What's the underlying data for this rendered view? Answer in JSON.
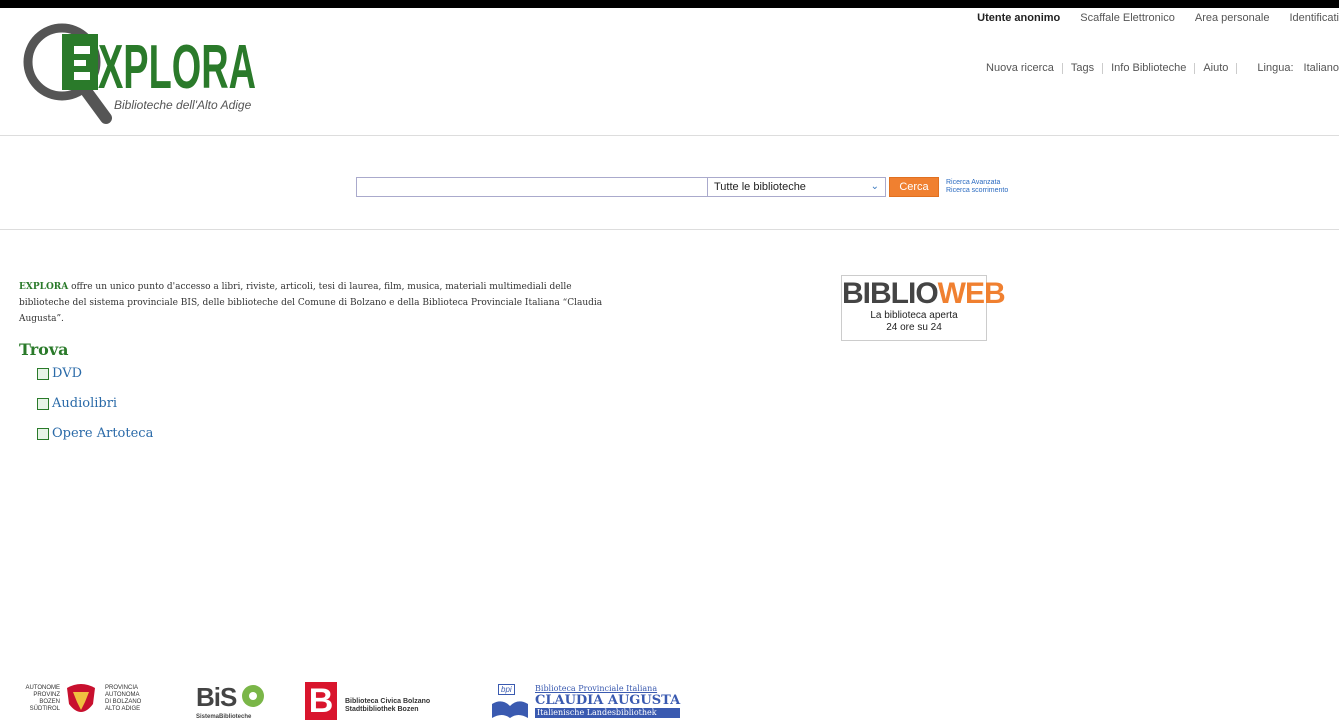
{
  "usernav": {
    "user": "Utente anonimo",
    "items": [
      "Scaffale Elettronico",
      "Area personale",
      "Identificati"
    ]
  },
  "logo": {
    "name": "EXPLORA",
    "subtitle": "Biblioteche dell'Alto Adige"
  },
  "mainnav": {
    "items": [
      "Nuova ricerca",
      "Tags",
      "Info Biblioteche",
      "Aiuto"
    ],
    "language_label": "Lingua:",
    "language_value": "Italiano"
  },
  "search": {
    "placeholder": "",
    "value": "",
    "library_select": "Tutte le biblioteche",
    "button": "Cerca",
    "advanced": "Ricerca Avanzata",
    "browse": "Ricerca scorrimento"
  },
  "intro": {
    "brand": "EXPLORA",
    "text": " offre un unico punto d'accesso a libri, riviste, articoli, tesi di laurea, film, musica, materiali multimediali delle biblioteche del sistema provinciale BIS, delle biblioteche del Comune di Bolzano e della Biblioteca Provinciale Italiana “Claudia Augusta”."
  },
  "find": {
    "title": "Trova",
    "links": [
      {
        "label": "DVD",
        "icon": "video-file-icon"
      },
      {
        "label": "Audiolibri",
        "icon": "audio-file-icon"
      },
      {
        "label": "Opere Artoteca",
        "icon": "image-icon"
      }
    ]
  },
  "biblioweb": {
    "title_a": "BIBLIO",
    "title_b": "WEB",
    "line1": "La biblioteca aperta",
    "line2": "24 ore su 24"
  },
  "footer": {
    "province_de": [
      "AUTONOME",
      "PROVINZ",
      "BOZEN",
      "SÜDTIROL"
    ],
    "province_it": [
      "PROVINCIA",
      "AUTONOMA",
      "DI BOLZANO",
      "ALTO ADIGE"
    ],
    "bis_name": "BiS",
    "bis_sub": "SistemaBiblioteche",
    "civica_line1": "Biblioteca Civica Bolzano",
    "civica_line2": "Stadtbibliothek Bozen",
    "claudia_line1": "Biblioteca Provinciale Italiana",
    "claudia_line2": "CLAUDIA AUGUSTA",
    "claudia_line3": "Italienische Landesbibliothek",
    "claudia_abbr": "bpi"
  },
  "colors": {
    "brand_green": "#2a7a2a",
    "accent_orange": "#f08030",
    "link_blue": "#2a6aa8"
  }
}
